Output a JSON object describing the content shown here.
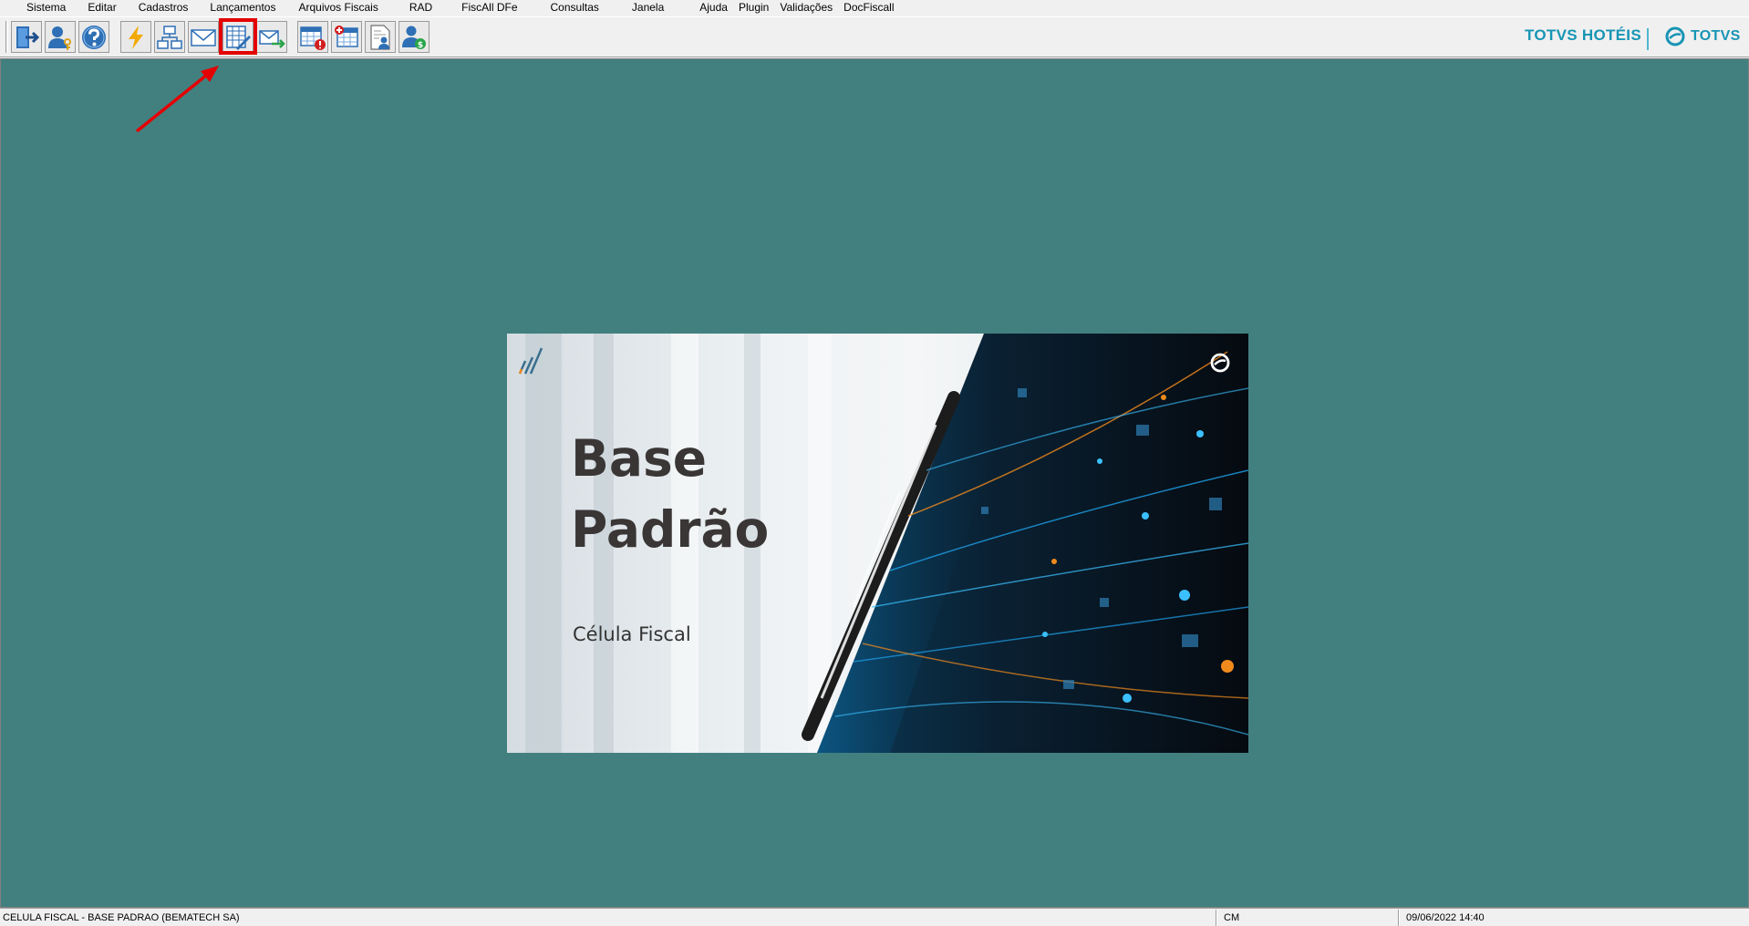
{
  "menu": {
    "items": [
      "Sistema",
      "Editar",
      "Cadastros",
      "Lançamentos",
      "Arquivos Fiscais",
      "RAD",
      "FiscAll DFe",
      "Consultas",
      "Janela",
      "Ajuda",
      "Plugin",
      "Validações",
      "DocFiscall"
    ]
  },
  "toolbar": {
    "buttons": [
      {
        "icon": "exit-door-icon"
      },
      {
        "icon": "user-key-icon"
      },
      {
        "icon": "help-icon"
      },
      {
        "icon": "lightning-icon"
      },
      {
        "icon": "network-icon"
      },
      {
        "icon": "mail-icon"
      },
      {
        "icon": "spreadsheet-edit-icon",
        "highlighted": true
      },
      {
        "icon": "mail-send-icon"
      },
      {
        "icon": "calendar-alert-icon"
      },
      {
        "icon": "calendar-add-icon"
      },
      {
        "icon": "document-user-icon"
      },
      {
        "icon": "user-money-icon"
      }
    ]
  },
  "brand": {
    "product": "TOTVS HOTÉIS",
    "company": "TOTVS"
  },
  "splash": {
    "title_line1": "Base",
    "title_line2": "Padrão",
    "subtitle": "Célula Fiscal"
  },
  "statusbar": {
    "company": "CELULA FISCAL - BASE PADRAO (BEMATECH SA)",
    "code": "CM",
    "datetime": "09/06/2022 14:40"
  },
  "colors": {
    "workspace": "#428080",
    "brand": "#1795b4",
    "highlight": "#e40000"
  }
}
